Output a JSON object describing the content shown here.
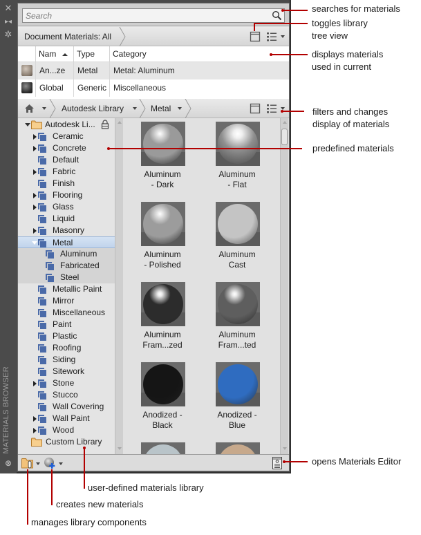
{
  "side_strip": {
    "close_icon": "close-icon",
    "auto_hide_icon": "auto-hide-icon",
    "properties_icon": "properties-icon",
    "title": "MATERIALS BROWSER",
    "bottom_icon": "palette-options-icon"
  },
  "search": {
    "placeholder": "Search",
    "value": ""
  },
  "document_bar": {
    "label": "Document Materials: All",
    "toggle_tree_icon": "panel-toggle-icon",
    "view_options_icon": "list-view-icon"
  },
  "document_table": {
    "columns": [
      "",
      "Nam",
      "Type",
      "Category"
    ],
    "sort_column": "Nam",
    "sort_direction": "ascending",
    "rows": [
      {
        "swatch": "anodized-bronze",
        "name": "An...ze",
        "type": "Metal",
        "category": "Metal: Aluminum"
      },
      {
        "swatch": "global-dark",
        "name": "Global",
        "type": "Generic",
        "category": "Miscellaneous"
      }
    ]
  },
  "library_bar": {
    "home_icon": "home-icon",
    "crumbs": [
      "Autodesk Library",
      "Metal"
    ]
  },
  "tree": {
    "root": {
      "label": "Autodesk Li...",
      "locked": true,
      "expanded": true
    },
    "items": [
      {
        "label": "Ceramic",
        "expandable": true
      },
      {
        "label": "Concrete",
        "expandable": true
      },
      {
        "label": "Default",
        "expandable": false
      },
      {
        "label": "Fabric",
        "expandable": true
      },
      {
        "label": "Finish",
        "expandable": false
      },
      {
        "label": "Flooring",
        "expandable": true
      },
      {
        "label": "Glass",
        "expandable": true
      },
      {
        "label": "Liquid",
        "expandable": false
      },
      {
        "label": "Masonry",
        "expandable": true
      },
      {
        "label": "Metal",
        "expandable": true,
        "expanded": true,
        "selected": true
      },
      {
        "label": "Aluminum",
        "child": true
      },
      {
        "label": "Fabricated",
        "child": true
      },
      {
        "label": "Steel",
        "child": true
      },
      {
        "label": "Metallic Paint",
        "expandable": false
      },
      {
        "label": "Mirror",
        "expandable": false
      },
      {
        "label": "Miscellaneous",
        "expandable": false
      },
      {
        "label": "Paint",
        "expandable": false
      },
      {
        "label": "Plastic",
        "expandable": false
      },
      {
        "label": "Roofing",
        "expandable": false
      },
      {
        "label": "Siding",
        "expandable": false
      },
      {
        "label": "Sitework",
        "expandable": false
      },
      {
        "label": "Stone",
        "expandable": true
      },
      {
        "label": "Stucco",
        "expandable": false
      },
      {
        "label": "Wall Covering",
        "expandable": false
      },
      {
        "label": "Wall Paint",
        "expandable": true
      },
      {
        "label": "Wood",
        "expandable": true
      }
    ],
    "custom_library": "Custom Library"
  },
  "materials": [
    {
      "line1": "Aluminum",
      "line2": "- Dark",
      "color": "#9a9a9a",
      "shine": "glossy"
    },
    {
      "line1": "Aluminum",
      "line2": "- Flat",
      "color": "#8e8e8e",
      "shine": "bright"
    },
    {
      "line1": "Aluminum",
      "line2": "- Polished",
      "color": "#9c9c9c",
      "shine": "glossy"
    },
    {
      "line1": "Aluminum",
      "line2": "Cast",
      "color": "#c4c4c4",
      "shine": "matte"
    },
    {
      "line1": "Aluminum",
      "line2": "Fram...zed",
      "color": "#2c2c2c",
      "shine": "glossy"
    },
    {
      "line1": "Aluminum",
      "line2": "Fram...ted",
      "color": "#5e5e5e",
      "shine": "glossy"
    },
    {
      "line1": "Anodized -",
      "line2": "Black",
      "color": "#151515",
      "shine": "matte"
    },
    {
      "line1": "Anodized -",
      "line2": "Blue",
      "color": "#2f6cc0",
      "shine": "matte"
    },
    {
      "line1": "",
      "line2": "",
      "color": "#b9c4c9",
      "shine": "matte"
    },
    {
      "line1": "",
      "line2": "",
      "color": "#c7a98c",
      "shine": "matte"
    }
  ],
  "bottom_toolbar": {
    "manage_library_icon": "library-manage-icon",
    "create_material_icon": "create-material-icon",
    "materials_editor_icon": "materials-editor-icon"
  },
  "annotations": {
    "search": "searches for materials",
    "toggle_line1": "toggles library",
    "toggle_line2": "tree view",
    "displays_line1": "displays materials",
    "displays_line2": "used in current",
    "filters_line1": "filters and changes",
    "filters_line2": "display of materials",
    "predefined": "predefined materials",
    "editor": "opens Materials Editor",
    "user_defined": "user-defined materials library",
    "creates": "creates new materials",
    "manages": "manages library components"
  },
  "colors": {
    "callout": "#b20000",
    "selection": "#c8d9ef",
    "category_icon": "#4a6aa8"
  }
}
